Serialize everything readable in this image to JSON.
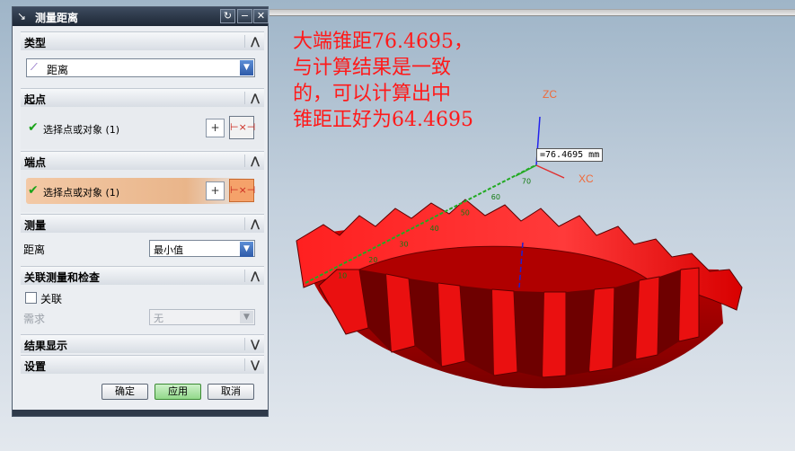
{
  "dialog": {
    "title": "测量距离",
    "sections": {
      "type": {
        "label": "类型",
        "value": "距离"
      },
      "start": {
        "label": "起点",
        "select_text": "选择点或对象 (1)"
      },
      "end": {
        "label": "端点",
        "select_text": "选择点或对象 (1)"
      },
      "measure": {
        "label": "测量",
        "distance_label": "距离",
        "distance_value": "最小值"
      },
      "associative": {
        "label": "关联测量和检查",
        "checkbox_label": "关联",
        "required_label": "需求",
        "required_value": "无"
      },
      "result": {
        "label": "结果显示"
      },
      "settings": {
        "label": "设置"
      }
    },
    "buttons": {
      "ok": "确定",
      "apply": "应用",
      "cancel": "取消"
    }
  },
  "viewport": {
    "annotation": "大端锥距76.4695，\n与计算结果是一致\n的，可以计算出中\n锥距正好为64.4695",
    "axes": {
      "zc": "ZC",
      "xc": "XC"
    },
    "measurement_readout": "=76.4695 mm",
    "ruler_ticks": [
      "10",
      "20",
      "30",
      "40",
      "50",
      "60",
      "70"
    ]
  },
  "colors": {
    "gear": "#e00000",
    "ruler": "#22aa22",
    "annotation": "#ff1a1a"
  }
}
